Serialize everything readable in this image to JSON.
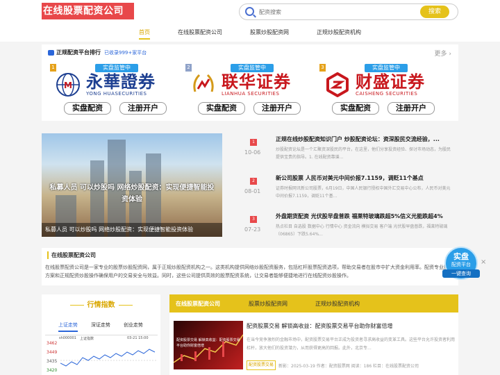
{
  "header": {
    "logo": "在线股票配资公司",
    "search_placeholder": "配资搜索",
    "search_button": "搜索"
  },
  "nav": [
    "首页",
    "在线股票配资公司",
    "股票炒股配资网",
    "正规炒股配资机构"
  ],
  "ranking": {
    "title": "正规配资平台排行",
    "count": "已收录999+家平台",
    "more": "更多",
    "badge": "实盘监管中",
    "btn_trade": "实盘配资",
    "btn_register": "注册开户",
    "cards": [
      {
        "rank": "1",
        "name": "永華證券",
        "en": "YONG HUASECURITIES",
        "color": "#1d3f91",
        "rank_color": "#e5a21b"
      },
      {
        "rank": "2",
        "name": "联华证券",
        "en": "LIANHUA SECURITIES",
        "color": "#c8171d",
        "rank_color": "#8fa2c9"
      },
      {
        "rank": "3",
        "name": "财盛证券",
        "en": "CAISHENG SECURITIES",
        "color": "#c8171d",
        "rank_color": "#e5a21b"
      }
    ]
  },
  "hero": {
    "title": "私募人员 可以炒股吗 网络炒股配资：实现便捷智能投资体验",
    "caption": "私募人员 可以炒股吗 网络炒股配资：实现便捷智能投资体验"
  },
  "news": [
    {
      "rank": "1",
      "date": "10-06",
      "title": "正规在线炒股配资知识门户 炒股配资论坛：资深股民交流经验，...",
      "summary": "炒股配资论坛是一个汇聚资深股民的平台，在这里，他们分享投资经验、探讨市场动态，为股民提供宝贵的指导。1. 在线配资靠谱..."
    },
    {
      "rank": "2",
      "date": "08-01",
      "title": "新公司股票 人民币对美元中间价报7.1159，调贬11个基点",
      "summary": "证券时报网讯新公司股票，6月19日，中国人民银行授权中国外汇交易中心公布，人民币对美元中间价报7.1159，调贬11个基..."
    },
    {
      "rank": "3",
      "date": "07-23",
      "title": "外盘期货配资 光伏股早盘普跌 福莱特玻璃跌超5%信义光能跌超4%",
      "summary": "热点栏目 自选股 数据中心 行情中心 资金流向 模拟交易 客户端 光伏股早盘普跌，福莱特玻璃（06865）下跌5.64%..."
    }
  ],
  "about": {
    "title": "在线股票配资公司",
    "text": "在线股票配资公司是一家专业的股票炒股配资网，属于正规炒股配资机构之一。这类机构提供网络炒股配资服务，包括杠杆股票配资选项，帮助交易者在股市中扩大资金利用率。配资专业股票方案和正规配资炒股操作确保用户的交易安全与效益。同时，这些公司提供高效的股票配资系统，让交易者能够便捷地进行在线配资炒股操作。"
  },
  "float_widget": {
    "line1": "实盘",
    "line2": "配资平台",
    "line3": "一键查询",
    "close": "×"
  },
  "market": {
    "title": "行情指数",
    "tabs": [
      "上证走势",
      "深证走势",
      "创业走势"
    ],
    "chart_header_code": "sh000001",
    "chart_header_name": "上证指数",
    "chart_header_time": "03-21 15:00",
    "y_labels": [
      "3462",
      "3449",
      "3435",
      "3420"
    ]
  },
  "news2": {
    "tabs": [
      "在线股票配资公司",
      "股票炒股配资网",
      "正规炒股配资机构"
    ],
    "image_text": "配资股票交易 解锁高收益：配资股票交易平台助你财富倍增",
    "title": "配资股票交易 解锁高收益：配资股票交易平台助你财富倍增",
    "summary": "在当今竞争激烈的金融市场中，配资股票交易平台正成为投资者寻求高收益的变革工具。这些平台允许投资者利用杠杆，放大他们的投资潜力，从而获得更高的回报。此外，北京专...",
    "tag": "配资股票交易",
    "meta": "新影：2025-03-19  作者：配资股票网 阅读：186  栏目：在线股票配资公司"
  }
}
